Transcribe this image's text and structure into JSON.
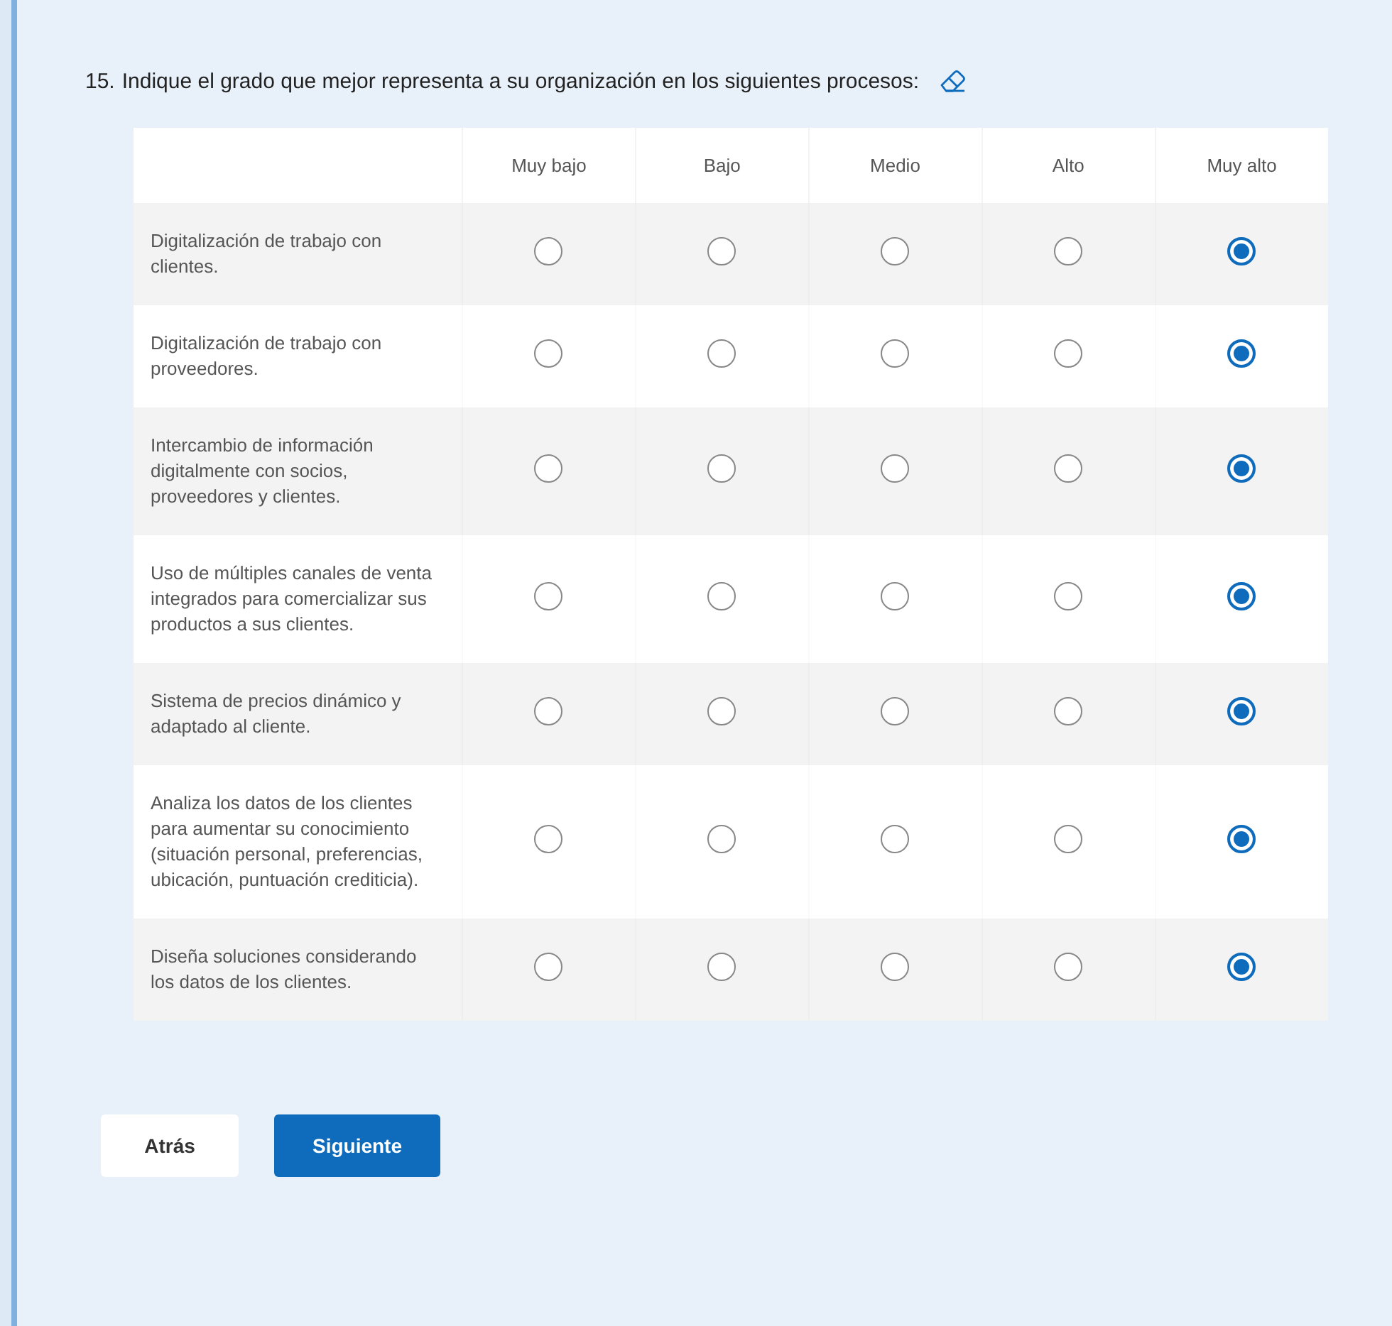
{
  "question": {
    "number": "15.",
    "text": "Indique el grado que mejor representa a su organización en los siguientes procesos:"
  },
  "columns": [
    "Muy bajo",
    "Bajo",
    "Medio",
    "Alto",
    "Muy alto"
  ],
  "rows": [
    {
      "label": "Digitalización de trabajo con clientes.",
      "options": [
        {
          "selected": false
        },
        {
          "selected": false
        },
        {
          "selected": false
        },
        {
          "selected": false
        },
        {
          "selected": true
        }
      ]
    },
    {
      "label": "Digitalización de trabajo con proveedores.",
      "options": [
        {
          "selected": false
        },
        {
          "selected": false
        },
        {
          "selected": false
        },
        {
          "selected": false
        },
        {
          "selected": true
        }
      ]
    },
    {
      "label": "Intercambio de información digitalmente con socios, proveedores y clientes.",
      "options": [
        {
          "selected": false
        },
        {
          "selected": false
        },
        {
          "selected": false
        },
        {
          "selected": false
        },
        {
          "selected": true
        }
      ]
    },
    {
      "label": "Uso de múltiples canales de venta integrados para comercializar sus productos a sus clientes.",
      "options": [
        {
          "selected": false
        },
        {
          "selected": false
        },
        {
          "selected": false
        },
        {
          "selected": false
        },
        {
          "selected": true
        }
      ]
    },
    {
      "label": "Sistema de precios dinámico y adaptado al cliente.",
      "options": [
        {
          "selected": false
        },
        {
          "selected": false
        },
        {
          "selected": false
        },
        {
          "selected": false
        },
        {
          "selected": true
        }
      ]
    },
    {
      "label": "Analiza los datos de los clientes para aumentar su conocimiento (situación personal, preferencias, ubicación, puntuación crediticia).",
      "options": [
        {
          "selected": false
        },
        {
          "selected": false
        },
        {
          "selected": false
        },
        {
          "selected": false
        },
        {
          "selected": true
        }
      ]
    },
    {
      "label": "Diseña soluciones considerando los datos de los clientes.",
      "options": [
        {
          "selected": false
        },
        {
          "selected": false
        },
        {
          "selected": false
        },
        {
          "selected": false
        },
        {
          "selected": true
        }
      ]
    }
  ],
  "buttons": [
    {
      "label": "Atrás",
      "kind": "secondary"
    },
    {
      "label": "Siguiente",
      "kind": "primary"
    }
  ]
}
